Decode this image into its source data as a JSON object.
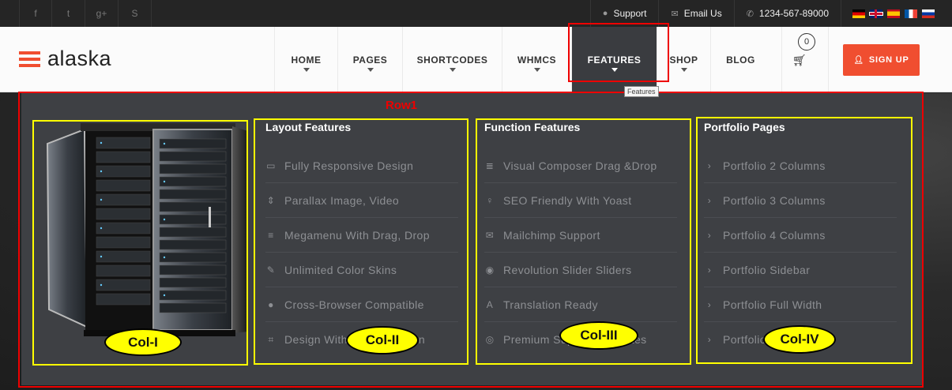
{
  "topbar": {
    "social": [
      {
        "icon": "facebook-icon",
        "glyph": "f"
      },
      {
        "icon": "twitter-icon",
        "glyph": "t"
      },
      {
        "icon": "google-plus-icon",
        "glyph": "g+"
      },
      {
        "icon": "skype-icon",
        "glyph": "S"
      }
    ],
    "support_label": "Support",
    "email_label": "Email Us",
    "phone": "1234-567-89000",
    "flags": [
      "de",
      "gb",
      "es",
      "fr",
      "ru"
    ]
  },
  "header": {
    "logo_text": "alaska",
    "nav": [
      {
        "label": "HOME",
        "name": "nav-home",
        "width": 80
      },
      {
        "label": "PAGES",
        "name": "nav-pages",
        "width": 82
      },
      {
        "label": "SHORTCODES",
        "name": "nav-shortcodes",
        "width": 126
      },
      {
        "label": "WHMCS",
        "name": "nav-whmcs",
        "width": 88
      },
      {
        "label": "FEATURES",
        "name": "nav-features",
        "width": 108,
        "active": true
      },
      {
        "label": "SHOP",
        "name": "nav-shop",
        "width": 68
      },
      {
        "label": "BLOG",
        "name": "nav-blog",
        "width": 76
      }
    ],
    "cart_count": "0",
    "signup_label": "SIGN UP",
    "tooltip": "Features"
  },
  "annotations": {
    "row_label": "Row1",
    "col_labels": [
      "Col-I",
      "Col-II",
      "Col-III",
      "Col-IV"
    ]
  },
  "mega": {
    "columns": [
      {
        "title": "Layout Features",
        "items": [
          {
            "label": "Fully Responsive Design",
            "icon": "desktop-icon",
            "glyph": "▭"
          },
          {
            "label": "Parallax Image, Video",
            "icon": "sort-icon",
            "glyph": "⇕"
          },
          {
            "label": "Megamenu With Drag, Drop",
            "icon": "list-icon",
            "glyph": "≡"
          },
          {
            "label": "Unlimited Color Skins",
            "icon": "eyedropper-icon",
            "glyph": "✎"
          },
          {
            "label": "Cross-Browser Compatible",
            "icon": "globe-icon",
            "glyph": "●"
          },
          {
            "label": "Design With Customization",
            "icon": "crop-icon",
            "glyph": "⌗"
          }
        ]
      },
      {
        "title": "Function Features",
        "items": [
          {
            "label": "Visual Composer Drag &Drop",
            "icon": "align-left-icon",
            "glyph": "≣"
          },
          {
            "label": "SEO Friendly With Yoast",
            "icon": "lightbulb-icon",
            "glyph": "♀"
          },
          {
            "label": "Mailchimp Support",
            "icon": "envelope-icon",
            "glyph": "✉"
          },
          {
            "label": "Revolution Slider Sliders",
            "icon": "eye-icon",
            "glyph": "◉"
          },
          {
            "label": "Translation Ready",
            "icon": "font-icon",
            "glyph": "A"
          },
          {
            "label": "Premium Supports Updates",
            "icon": "life-ring-icon",
            "glyph": "◎"
          }
        ]
      },
      {
        "title": "Portfolio Pages",
        "items": [
          {
            "label": "Portfolio 2 Columns",
            "icon": "chevron-right-icon",
            "glyph": "›"
          },
          {
            "label": "Portfolio 3 Columns",
            "icon": "chevron-right-icon",
            "glyph": "›"
          },
          {
            "label": "Portfolio 4 Columns",
            "icon": "chevron-right-icon",
            "glyph": "›"
          },
          {
            "label": "Portfolio Sidebar",
            "icon": "chevron-right-icon",
            "glyph": "›"
          },
          {
            "label": "Portfolio Full Width",
            "icon": "chevron-right-icon",
            "glyph": "›"
          },
          {
            "label": "Portfolio Single Page",
            "icon": "chevron-right-icon",
            "glyph": "›"
          }
        ]
      }
    ]
  },
  "colors": {
    "accent": "#f04e30",
    "menu_bg": "#3e4044",
    "annotation_red": "#ee0000",
    "annotation_yellow": "#ffff00"
  }
}
